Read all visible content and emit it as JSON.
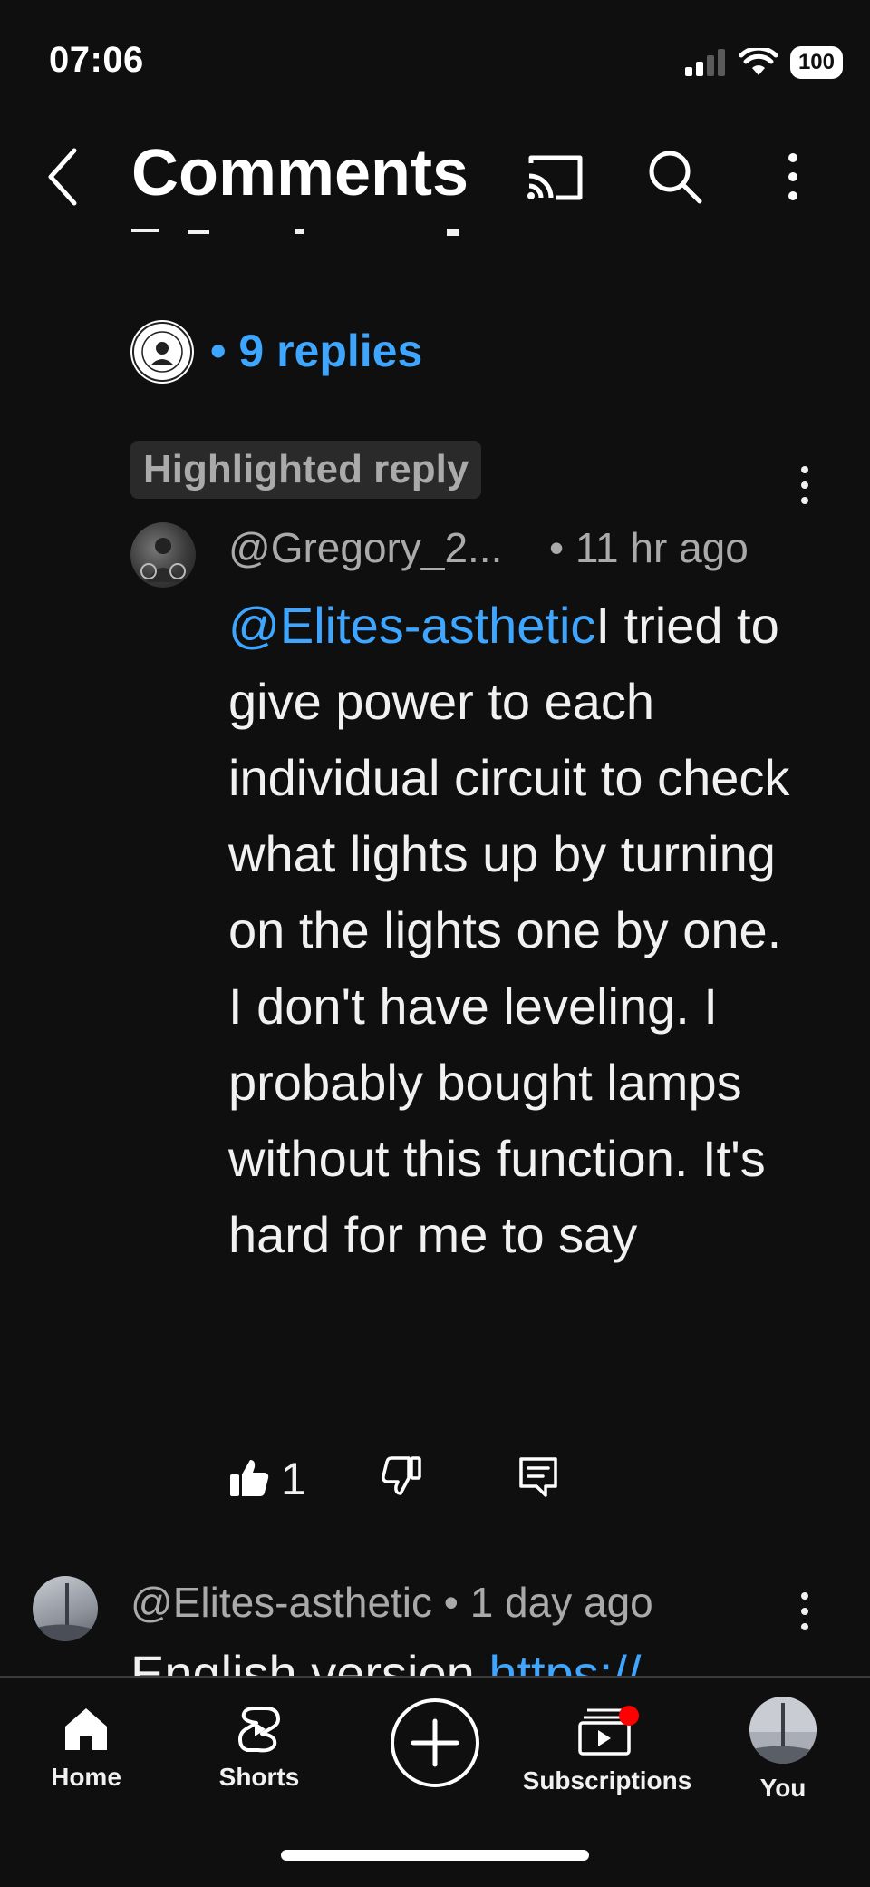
{
  "status_bar": {
    "time": "07:06",
    "battery": "100"
  },
  "header": {
    "title": "Comments",
    "icons": [
      "back-icon",
      "cast-icon",
      "search-icon",
      "more-vert-icon"
    ]
  },
  "thread": {
    "replies_label": "• 9 replies"
  },
  "highlighted_reply": {
    "badge": "Highlighted reply",
    "author": "@Gregory_2...",
    "time": "• 11 hr ago",
    "mention": "@Elites-asthetic",
    "text": "I tried to give power to each individual circuit to check what lights up by turning on the lights one by one. I don't have leveling. I probably bought lamps without this function. It's hard for me to say",
    "likes": "1"
  },
  "next_comment": {
    "author": "@Elites-asthetic • 1 day ago",
    "text_start": "English version ",
    "link_start": "https://"
  },
  "bottom_nav": {
    "items": [
      {
        "label": "Home",
        "icon": "home-icon"
      },
      {
        "label": "Shorts",
        "icon": "shorts-icon"
      },
      {
        "label": "",
        "icon": "create-icon"
      },
      {
        "label": "Subscriptions",
        "icon": "subscriptions-icon"
      },
      {
        "label": "You",
        "icon": "you-avatar"
      }
    ]
  },
  "colors": {
    "background": "#0f0f0f",
    "link": "#3ea6ff",
    "secondary_text": "#aaaaaa",
    "notification_dot": "#ff0000"
  }
}
